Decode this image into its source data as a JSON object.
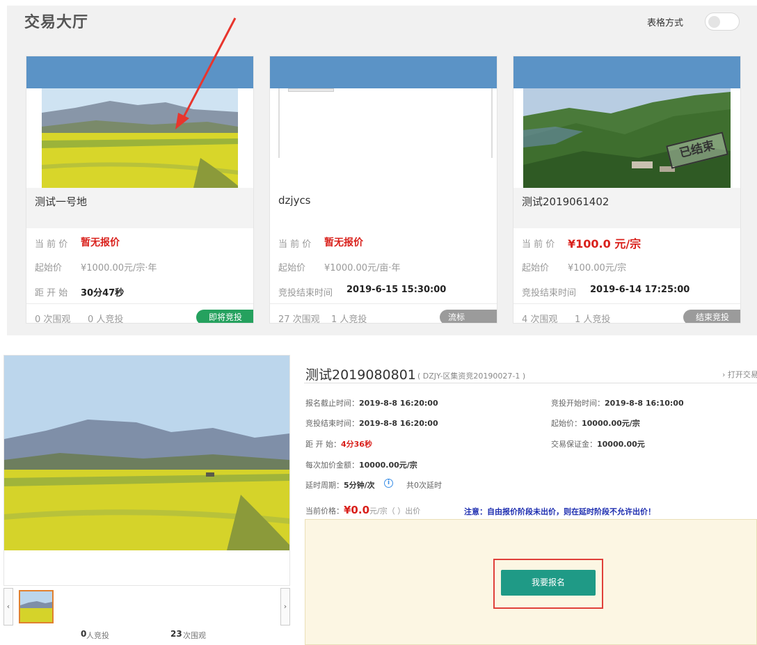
{
  "colors": {
    "accent_blue": "#5b93c6",
    "price_red": "#d9201b",
    "green_badge": "#25a15e",
    "gray_badge": "#9b9b9b",
    "teal_button": "#1f9a86"
  },
  "hall": {
    "title": "交易大厅",
    "table_mode_label": "表格方式"
  },
  "cards": [
    {
      "name": "测试一号地",
      "current_label": "当 前 价",
      "current_value": "暂无报价",
      "start_label": "起始价",
      "start_value": "¥1000.00元/宗·年",
      "row3_label": "距 开 始",
      "row3_value": "30分47秒",
      "views": "0 次围观",
      "bidders": "0 人竞投",
      "badge": "即将竞投"
    },
    {
      "name": "dzjycs",
      "current_label": "当 前 价",
      "current_value": "暂无报价",
      "start_label": "起始价",
      "start_value": "¥1000.00元/亩·年",
      "row3_label": "竞投结束时间",
      "row3_value": "2019-6-15 15:30:00",
      "views": "27 次围观",
      "bidders": "1 人竞投",
      "badge": "流标"
    },
    {
      "name": "测试2019061402",
      "current_label": "当 前 价",
      "current_value": "¥100.0 元/宗",
      "start_label": "起始价",
      "start_value": "¥100.00元/宗",
      "row3_label": "竞投结束时间",
      "row3_value": "2019-6-14 17:25:00",
      "views": "4 次围观",
      "bidders": "1 人竞投",
      "badge": "结束竞投",
      "stamp": "已结束"
    }
  ],
  "detail": {
    "title": "测试2019080801",
    "code": "( DZJY-区集资竞20190027-1 )",
    "open_link": "› 打开交易",
    "reg_deadline_label": "报名截止时间：",
    "reg_deadline": "2019-8-8 16:20:00",
    "bid_start_label": "竞投开始时间：",
    "bid_start": "2019-8-8 16:10:00",
    "bid_end_label": "竞投结束时间：",
    "bid_end": "2019-8-8 16:20:00",
    "start_price_label": "起始价：",
    "start_price": "10000.00元/宗",
    "countdown_label": "距 开 始：",
    "countdown": "4分36秒",
    "deposit_label": "交易保证金：",
    "deposit": "10000.00元",
    "increment_label": "每次加价金额：",
    "increment": "10000.00元/宗",
    "delay_label": "延时周期：",
    "delay": "5分钟/次",
    "delay_count": "共0次延时",
    "current_price_label": "当前价格：",
    "current_price": "¥0.0",
    "current_price_unit": "元/宗（ ）出价",
    "warning": "注意：自由报价阶段未出价，则在延时阶段不允许出价！",
    "signup_button": "我要报名",
    "bidders_count": "0",
    "bidders_text": "人竞投",
    "views_count": "23",
    "views_text": "次围观"
  }
}
